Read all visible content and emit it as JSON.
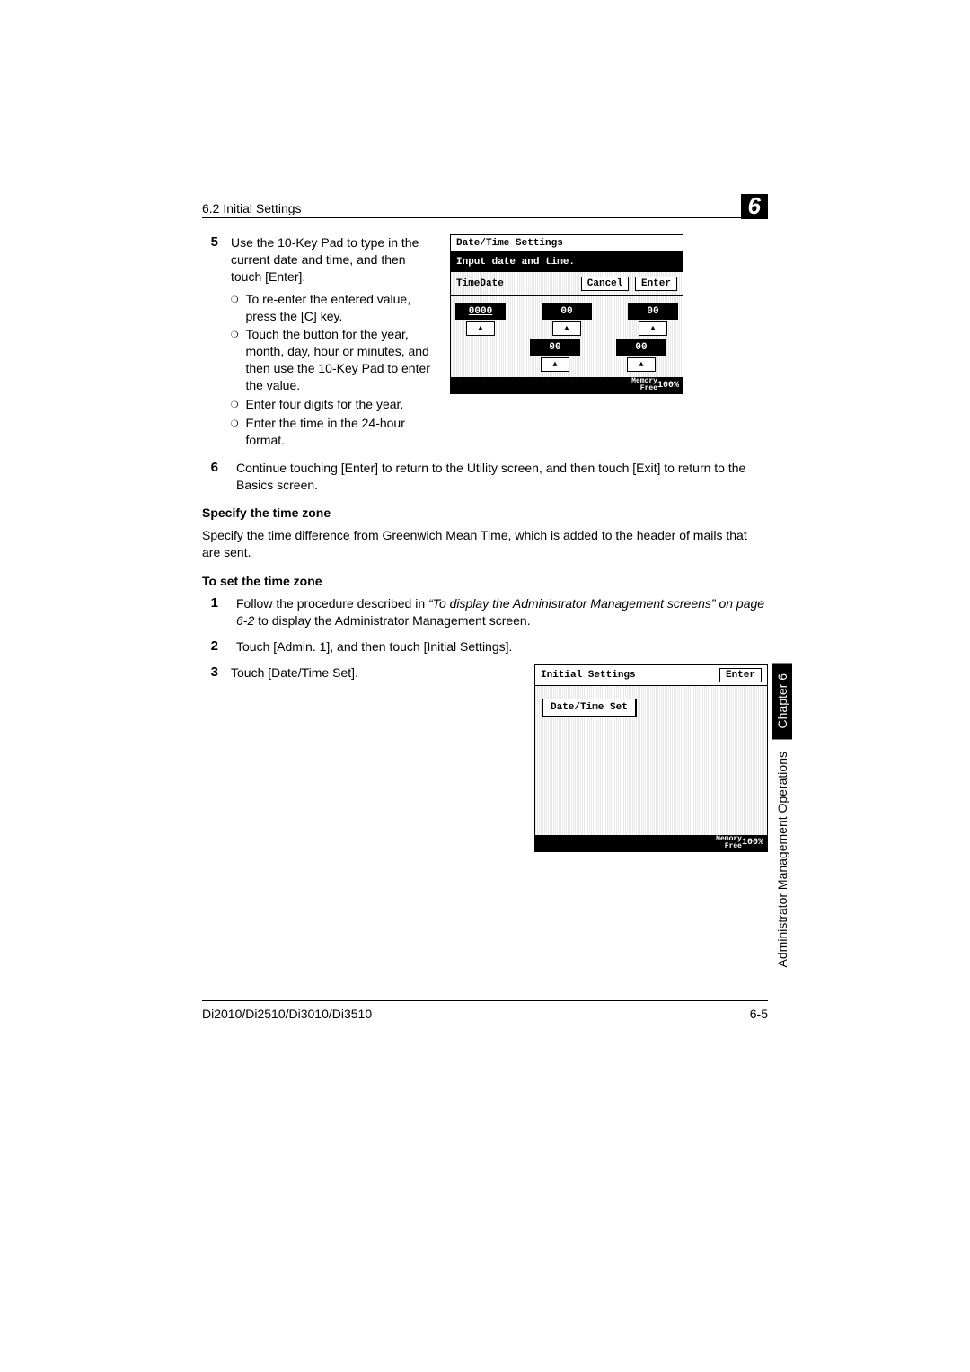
{
  "header": {
    "section": "6.2 Initial Settings",
    "chapter_num": "6"
  },
  "step5": {
    "num": "5",
    "text": "Use the 10-Key Pad to type in the current date and time, and then touch [Enter].",
    "bullets": [
      "To re-enter the entered value, press the [C] key.",
      "Touch the button for the year, month, day, hour or minutes, and then use the 10-Key Pad to enter the value.",
      "Enter four digits for the year.",
      "Enter the time in the 24-hour format."
    ]
  },
  "screen1": {
    "title": "Date/Time Settings",
    "msg": "Input date and time.",
    "row_label": "TimeDate",
    "cancel": "Cancel",
    "enter": "Enter",
    "year": "0000",
    "v1": "00",
    "v2": "00",
    "v3": "00",
    "v4": "00",
    "mem_label": "Memory\nFree",
    "mem_val": "100%"
  },
  "step6": {
    "num": "6",
    "text": "Continue touching [Enter] to return to the Utility screen, and then touch [Exit] to return to the Basics screen."
  },
  "tz_head": "Specify the time zone",
  "tz_text": "Specify the time difference from Greenwich Mean Time, which is added to the header of mails that are sent.",
  "set_head": "To set the time zone",
  "step1": {
    "num": "1",
    "pre": "Follow the procedure described in ",
    "ital": "“To display the Administrator Management screens” on page 6-2",
    "post": " to display the Administrator Management screen."
  },
  "step2": {
    "num": "2",
    "text": "Touch [Admin. 1], and then touch [Initial Settings]."
  },
  "step3": {
    "num": "3",
    "text": "Touch [Date/Time Set]."
  },
  "screen2": {
    "title": "Initial Settings",
    "enter": "Enter",
    "btn": "Date/Time Set",
    "mem_label": "Memory\nFree",
    "mem_val": "100%"
  },
  "side": {
    "chapter": "Chapter 6",
    "section": "Administrator Management Operations"
  },
  "footer": {
    "left": "Di2010/Di2510/Di3010/Di3510",
    "right": "6-5"
  }
}
